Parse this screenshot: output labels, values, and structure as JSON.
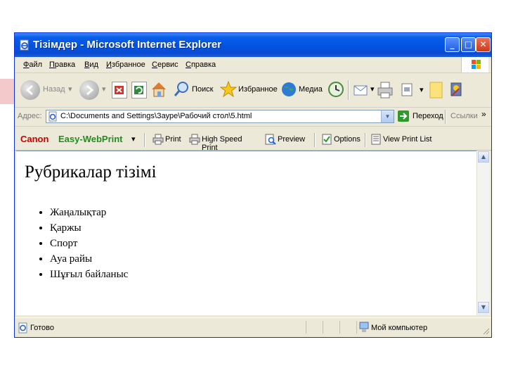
{
  "window": {
    "title": "Тізімдер - Microsoft Internet Explorer",
    "controls": {
      "minimize": "_",
      "maximize": "□",
      "close": "✕"
    }
  },
  "menu": {
    "items": [
      {
        "first": "Ф",
        "rest": "айл"
      },
      {
        "first": "П",
        "rest": "равка"
      },
      {
        "first": "В",
        "rest": "ид"
      },
      {
        "first": "И",
        "rest": "збранное"
      },
      {
        "first": "С",
        "rest": "ервис"
      },
      {
        "first": "С",
        "rest": "правка"
      }
    ]
  },
  "toolbar": {
    "back_label": "Назад",
    "search_label": "Поиск",
    "favorites_label": "Избранное",
    "media_label": "Медиа",
    "dropdown_arrow": "▾"
  },
  "address": {
    "label": "Адрес:",
    "value": "C:\\Documents and Settings\\Зауре\\Рабочий стол\\5.html",
    "go_label": "Переход",
    "links_label": "Ссылки",
    "chevron": "»",
    "drop_arrow": "▼"
  },
  "canon": {
    "brand": "Canon",
    "product": "Easy-WebPrint",
    "arrow": "▾",
    "print": "Print",
    "high_speed": "High Speed Print",
    "preview": "Preview",
    "options": "Options",
    "view_print_list": "View Print List"
  },
  "page": {
    "heading": "Рубрикалар тізімі",
    "items": [
      "Жаңалықтар",
      "Қаржы",
      "Спорт",
      "Ауа райы",
      "Шұғыл байланыс"
    ]
  },
  "scroll": {
    "up": "▲",
    "down": "▼"
  },
  "status": {
    "text": "Готово",
    "zone": "Мой компьютер"
  },
  "colors": {
    "titlebar": "#0053e1",
    "chrome": "#ece9d8",
    "canon_red": "#cc0000",
    "canon_green": "#228b22",
    "go_green": "#2e9a2e"
  }
}
